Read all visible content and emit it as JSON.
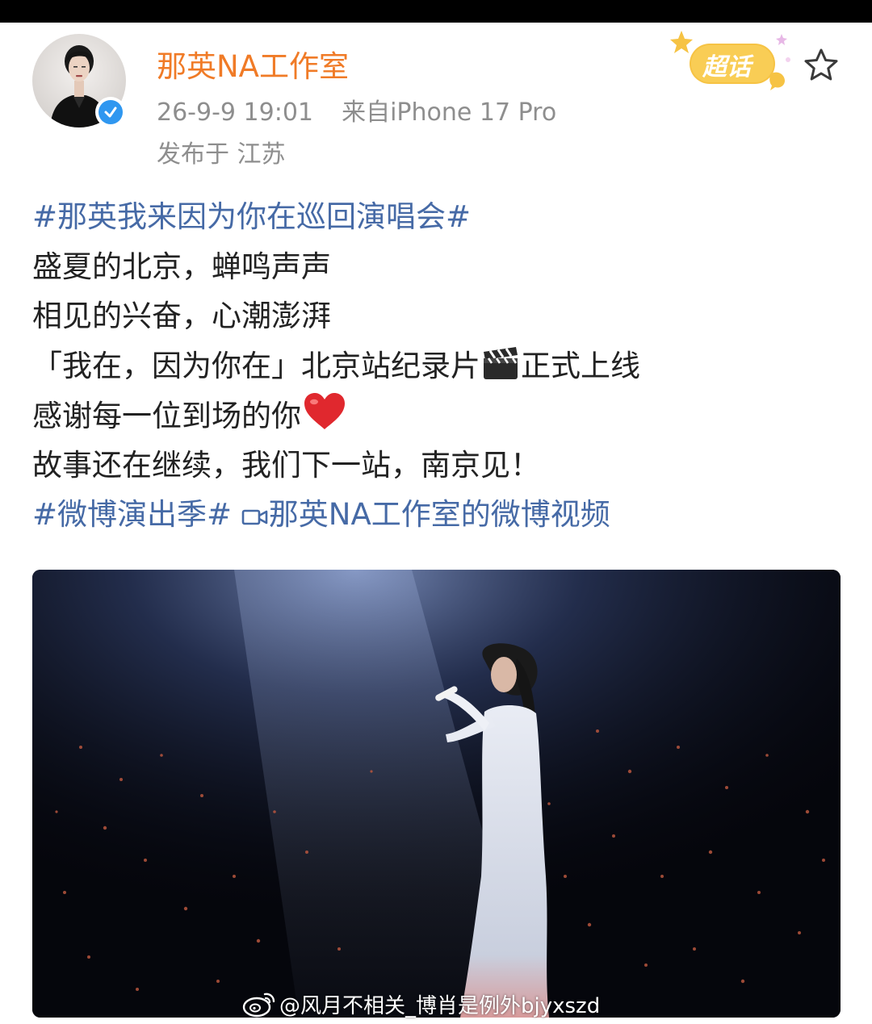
{
  "post": {
    "author": {
      "name": "那英NA工作室",
      "avatar_icon": "portrait-avatar",
      "verified_icon": "verified-check-icon"
    },
    "meta": {
      "date": "26-9-9 19:01",
      "source": "来自iPhone 17 Pro",
      "location": "发布于 江苏"
    },
    "supertopic_badge": "超话",
    "favorite_icon": "star-icon",
    "text": {
      "hashtag_1": "#那英我来因为你在巡回演唱会#",
      "line_2": "盛夏的北京，蝉鸣声声",
      "line_3": "相见的兴奋，心潮澎湃",
      "line_4_a": "「我在，因为你在」北京站纪录片",
      "line_4_emoji": "clapperboard-icon",
      "line_4_b": "正式上线",
      "line_5": "感谢每一位到场的你",
      "line_5_emoji": "red-heart-icon",
      "line_6": "故事还在继续，我们下一站，南京见！",
      "hashtag_2": "#微博演出季#",
      "video_link_icon": "video-camera-icon",
      "video_link": "那英NA工作室的微博视频"
    },
    "media": {
      "description_icon": "concert-video-thumbnail"
    },
    "watermark": {
      "logo_icon": "weibo-logo-icon",
      "text": "@风月不相关_博肖是例外bjyxszd"
    }
  },
  "colors": {
    "author_name": "#f07b27",
    "meta_gray": "#8e8e8e",
    "hashtag_blue": "#466aa6",
    "body_text": "#222222",
    "verified_blue": "#2f97f0",
    "supertopic_yellow": "#f6c344"
  }
}
